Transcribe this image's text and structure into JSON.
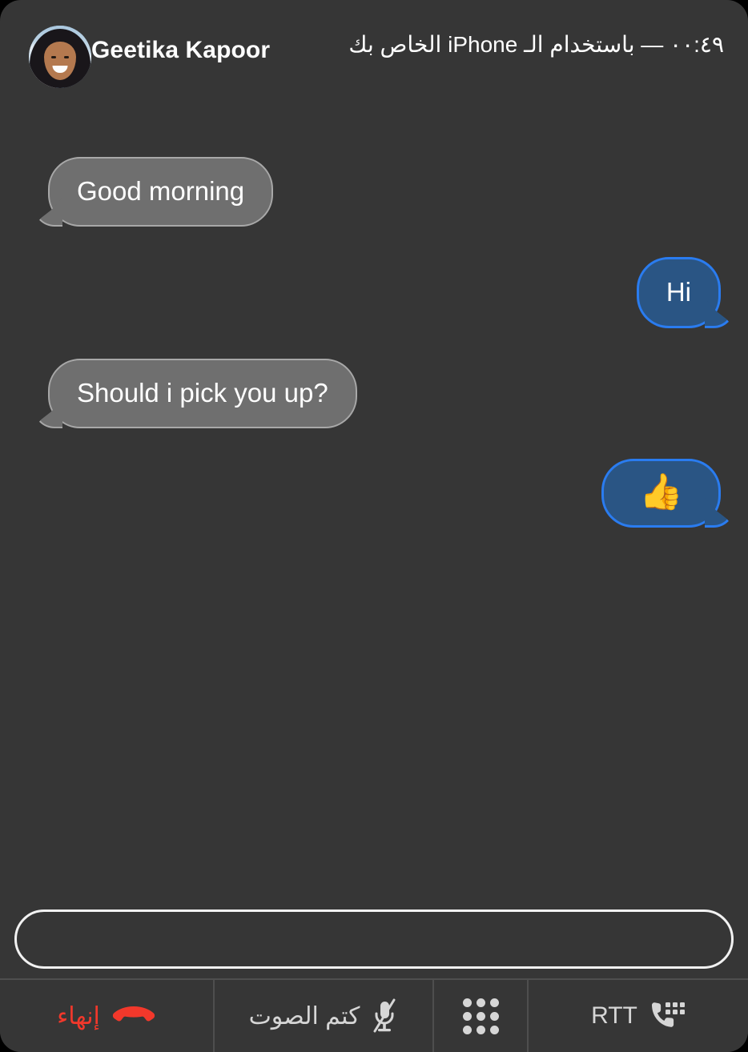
{
  "window": {
    "background_color": "#363636",
    "outer_color": "#000000"
  },
  "header": {
    "caller_name": "Geetika Kapoor",
    "call_status": "٠٠:٤٩ — باستخدام الـ iPhone الخاص بك",
    "duration": "٠٠:٤٩",
    "avatar_alt": "Geetika Kapoor"
  },
  "conversation": {
    "messages": [
      {
        "id": "msg-1",
        "text": "Good morning",
        "side": "incoming",
        "kind": "text"
      },
      {
        "id": "msg-2",
        "text": "Hi",
        "side": "outgoing",
        "kind": "text"
      },
      {
        "id": "msg-3",
        "text": "Should i pick you up?",
        "side": "incoming",
        "kind": "text"
      },
      {
        "id": "msg-4",
        "text": "👍",
        "side": "outgoing",
        "kind": "emoji"
      }
    ]
  },
  "input": {
    "value": "",
    "placeholder": ""
  },
  "toolbar": {
    "buttons": [
      {
        "id": "end",
        "label": "إنهاء",
        "icon": "phone-down-icon",
        "color": "#f2382b"
      },
      {
        "id": "mute",
        "label": "كتم الصوت",
        "icon": "microphone-slash-icon",
        "color": "#d6d6d6"
      },
      {
        "id": "keypad",
        "label": "",
        "icon": "keypad-grid-icon",
        "color": "#d6d6d6"
      },
      {
        "id": "rtt",
        "label": "RTT",
        "icon": "phone-keyboard-icon",
        "color": "#d6d6d6"
      }
    ]
  },
  "colors": {
    "bubble_incoming": "#6f6f6f",
    "bubble_incoming_border": "#a8a8a8",
    "bubble_outgoing": "#2a5584",
    "bubble_outgoing_border": "#2a7cf0",
    "end_call_red": "#f2382b",
    "text_primary": "#ffffff",
    "divider": "#4e4e4e"
  }
}
